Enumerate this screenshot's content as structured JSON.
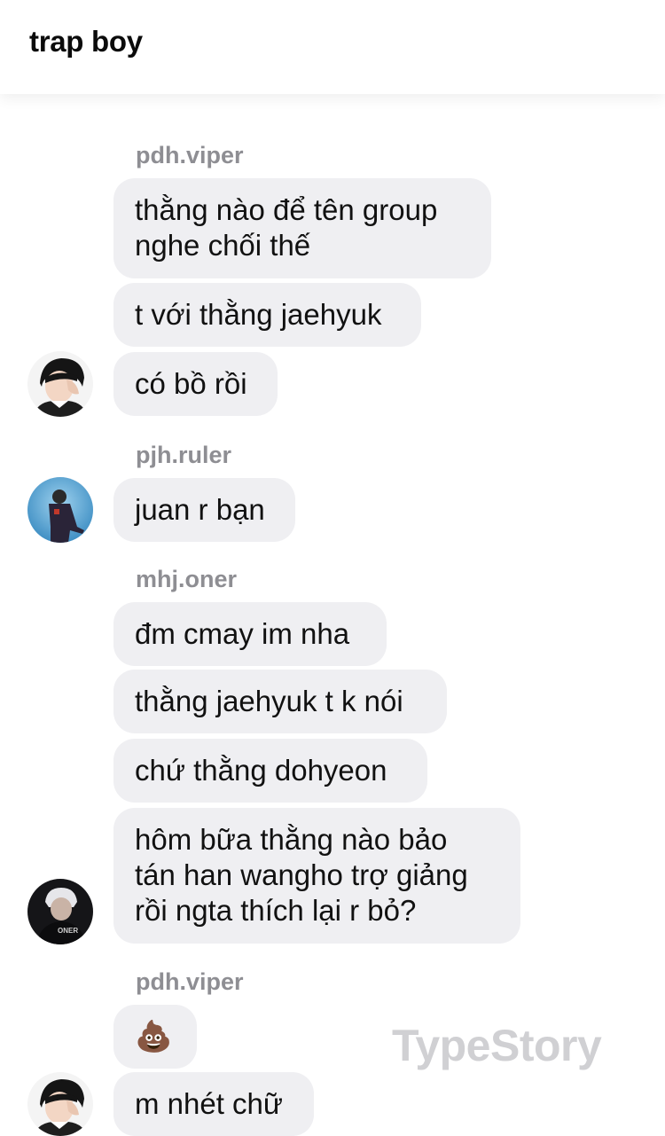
{
  "header": {
    "title": "trap boy"
  },
  "groups": [
    {
      "sender": "pdh.viper",
      "avatar": "viper-avatar",
      "messages": [
        "thằng nào để tên group\nnghe chối thế",
        "t với thằng jaehyuk",
        "có bồ rồi"
      ]
    },
    {
      "sender": "pjh.ruler",
      "avatar": "ruler-avatar",
      "messages": [
        "juan r bạn"
      ]
    },
    {
      "sender": "mhj.oner",
      "avatar": "oner-avatar",
      "avatar_text": "ONER",
      "messages": [
        "đm cmay im nha",
        "thằng jaehyuk t k nói",
        "chứ thằng dohyeon",
        "hôm bữa thằng nào bảo\ntán han wangho trợ giảng\nrồi ngta thích lại r bỏ?"
      ]
    },
    {
      "sender": "pdh.viper",
      "avatar": "viper-avatar",
      "messages": [
        "💩",
        "m nhét chữ"
      ]
    }
  ],
  "watermark": "TypeStory",
  "colors": {
    "bubble": "#efeff2",
    "sender": "#8e8e93",
    "watermark": "#d0d0d3"
  }
}
